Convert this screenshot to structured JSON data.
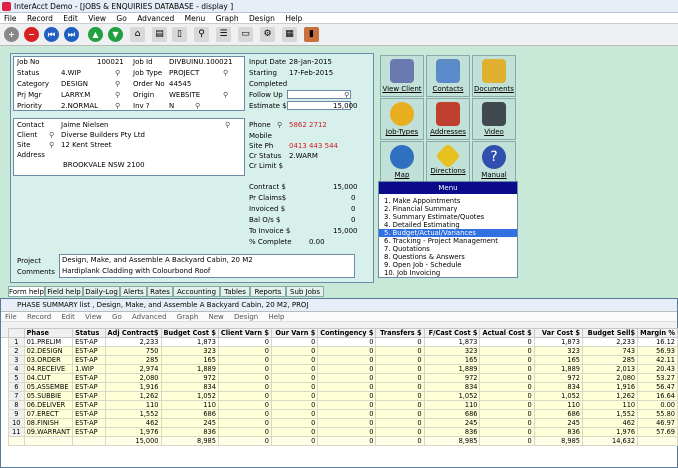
{
  "window": {
    "title": "InterAcct Demo - [JOBS & ENQUIRIES DATABASE - display ]"
  },
  "menubar": [
    "File",
    "Record",
    "Edit",
    "View",
    "Go",
    "Advanced",
    "Menu",
    "Graph",
    "Design",
    "Help"
  ],
  "form": {
    "job_no": {
      "label": "Job No",
      "value": "100021"
    },
    "status": {
      "label": "Status",
      "value": "4.WIP"
    },
    "category": {
      "label": "Category",
      "value": "DESIGN"
    },
    "prj_mgr": {
      "label": "Prj Mgr",
      "value": "LARRY.M"
    },
    "priority": {
      "label": "Priority",
      "value": "2.NORMAL"
    },
    "job_id": {
      "label": "Job Id",
      "value": "DIVBUINU.100021"
    },
    "job_type": {
      "label": "Job Type",
      "value": "PROJECT"
    },
    "order_no": {
      "label": "Order No",
      "value": "44545"
    },
    "origin": {
      "label": "Origin",
      "value": "WEBSITE"
    },
    "inv": {
      "label": "Inv ?",
      "value": "N"
    },
    "input_date": {
      "label": "Input Date",
      "value": "28-Jan-2015"
    },
    "starting": {
      "label": "Starting",
      "value": "17-Feb-2015"
    },
    "completed": {
      "label": "Completed",
      "value": ""
    },
    "follow_up": {
      "label": "Follow Up",
      "value": ""
    },
    "estimate": {
      "label": "Estimate $",
      "value": "15,000"
    },
    "contact": {
      "label": "Contact",
      "value": "Jaime Nielsen"
    },
    "client": {
      "label": "Client",
      "value": "Diverse Builders Pty Ltd"
    },
    "site": {
      "label": "Site",
      "value": "12 Kent Street"
    },
    "address": {
      "label": "Address",
      "value": "BROOKVALE NSW 2100"
    },
    "phone": {
      "label": "Phone",
      "value": "5862 2712"
    },
    "mobile": {
      "label": "Mobile",
      "value": ""
    },
    "site_ph": {
      "label": "Site Ph",
      "value": "0413 443 544"
    },
    "cr_status": {
      "label": "Cr Status",
      "value": "2.WARM"
    },
    "cr_limit": {
      "label": "Cr Limit $",
      "value": ""
    },
    "contract": {
      "label": "Contract $",
      "value": "15,000"
    },
    "pr_claims": {
      "label": "Pr Claims$",
      "value": "0"
    },
    "invoiced": {
      "label": "Invoiced $",
      "value": "0"
    },
    "bal_os": {
      "label": "Bal O/s $",
      "value": "0"
    },
    "to_invoice": {
      "label": "To Invoice $",
      "value": "15,000"
    },
    "pct_complete": {
      "label": "% Complete",
      "value": "0.00"
    },
    "project": {
      "label": "Project",
      "value": "Design, Make, and Assemble A Backyard Cabin, 20 M2"
    },
    "comments": {
      "label": "Comments",
      "value": "Hardiplank Cladding with Colourbond Roof"
    }
  },
  "nav_buttons": [
    {
      "label": "View Client",
      "icon": "people-icon",
      "color": "#6a7ab0"
    },
    {
      "label": "Contacts",
      "icon": "contacts-icon",
      "color": "#5a8ac8"
    },
    {
      "label": "Documents",
      "icon": "folder-icon",
      "color": "#e0b030"
    },
    {
      "label": "Job-Types",
      "icon": "worker-icon",
      "color": "#e8b020"
    },
    {
      "label": "Addresses",
      "icon": "house-icon",
      "color": "#c04030"
    },
    {
      "label": "Video",
      "icon": "video-camera-icon",
      "color": "#404850"
    },
    {
      "label": "Map",
      "icon": "globe-icon",
      "color": "#3070c0"
    },
    {
      "label": "Directions",
      "icon": "directions-sign-icon",
      "color": "#e8c020"
    },
    {
      "label": "Manual",
      "icon": "help-icon",
      "color": "#3050b0"
    }
  ],
  "menu": {
    "title": "Menu",
    "items": [
      "1. Make Appointments",
      "2. Financial Summary",
      "3. Summary Estimate/Quotes",
      "4. Detailed Estimating",
      "5. Budget/Actual/Variances",
      "6. Tracking - Project Management",
      "7. Quotations",
      "8. Questions & Answers",
      "9. Open Job - Schedule",
      "10. Job Invoicing"
    ],
    "selected_index": 4
  },
  "tabs": [
    "Form help",
    "Field help",
    "Daily-Log",
    "Alerts",
    "Rates",
    "Accounting",
    "Tables",
    "Reports",
    "Sub Jobs"
  ],
  "sub_window": {
    "title": "PHASE SUMMARY list , Design, Make, and Assemble A Backyard Cabin, 20 M2, PROJ",
    "menubar": [
      "File",
      "Record",
      "Edit",
      "View",
      "Go",
      "Advanced",
      "Graph",
      "New",
      "Design",
      "Help"
    ],
    "columns": [
      "",
      "Phase",
      "Status",
      "Adj Contract$",
      "Budget Cost $",
      "Client Varn $",
      "Our Varn $",
      "Contingency $",
      "Transfers $",
      "F/Cast Cost $",
      "Actual Cost $",
      "Var Cost $",
      "Budget Sell$",
      "Margin %"
    ],
    "rows": [
      [
        "1",
        "01.PRELIM",
        "EST-AP",
        "2,233",
        "1,873",
        "0",
        "0",
        "0",
        "0",
        "1,873",
        "0",
        "1,873",
        "2,233",
        "16.12"
      ],
      [
        "2",
        "02.DESIGN",
        "EST-AP",
        "750",
        "323",
        "0",
        "0",
        "0",
        "0",
        "323",
        "0",
        "323",
        "743",
        "56.93"
      ],
      [
        "3",
        "03.ORDER",
        "EST-AP",
        "285",
        "165",
        "0",
        "0",
        "0",
        "0",
        "165",
        "0",
        "165",
        "285",
        "42.11"
      ],
      [
        "4",
        "04.RECEIVE",
        "1.WIP",
        "2,974",
        "1,889",
        "0",
        "0",
        "0",
        "0",
        "1,889",
        "0",
        "1,889",
        "2,013",
        "20.43"
      ],
      [
        "5",
        "04.CUT",
        "EST-AP",
        "2,080",
        "972",
        "0",
        "0",
        "0",
        "0",
        "972",
        "0",
        "972",
        "2,080",
        "53.27"
      ],
      [
        "6",
        "05.ASSEMBE",
        "EST-AP",
        "1,916",
        "834",
        "0",
        "0",
        "0",
        "0",
        "834",
        "0",
        "834",
        "1,916",
        "56.47"
      ],
      [
        "7",
        "05.SUBBIE",
        "EST-AP",
        "1,262",
        "1,052",
        "0",
        "0",
        "0",
        "0",
        "1,052",
        "0",
        "1,052",
        "1,262",
        "16.64"
      ],
      [
        "8",
        "06.DELIVER",
        "EST-AP",
        "110",
        "110",
        "0",
        "0",
        "0",
        "0",
        "110",
        "0",
        "110",
        "110",
        "0.00"
      ],
      [
        "9",
        "07.ERECT",
        "EST-AP",
        "1,552",
        "686",
        "0",
        "0",
        "0",
        "0",
        "686",
        "0",
        "686",
        "1,552",
        "55.80"
      ],
      [
        "10",
        "08.FINISH",
        "EST-AP",
        "462",
        "245",
        "0",
        "0",
        "0",
        "0",
        "245",
        "0",
        "245",
        "462",
        "46.97"
      ],
      [
        "11",
        "09.WARRANT",
        "EST-AP",
        "1,976",
        "836",
        "0",
        "0",
        "0",
        "0",
        "836",
        "0",
        "836",
        "1,976",
        "57.69"
      ]
    ],
    "totals": [
      "",
      "",
      "",
      "15,000",
      "8,985",
      "0",
      "0",
      "0",
      "0",
      "8,985",
      "0",
      "8,985",
      "14,632",
      ""
    ]
  }
}
